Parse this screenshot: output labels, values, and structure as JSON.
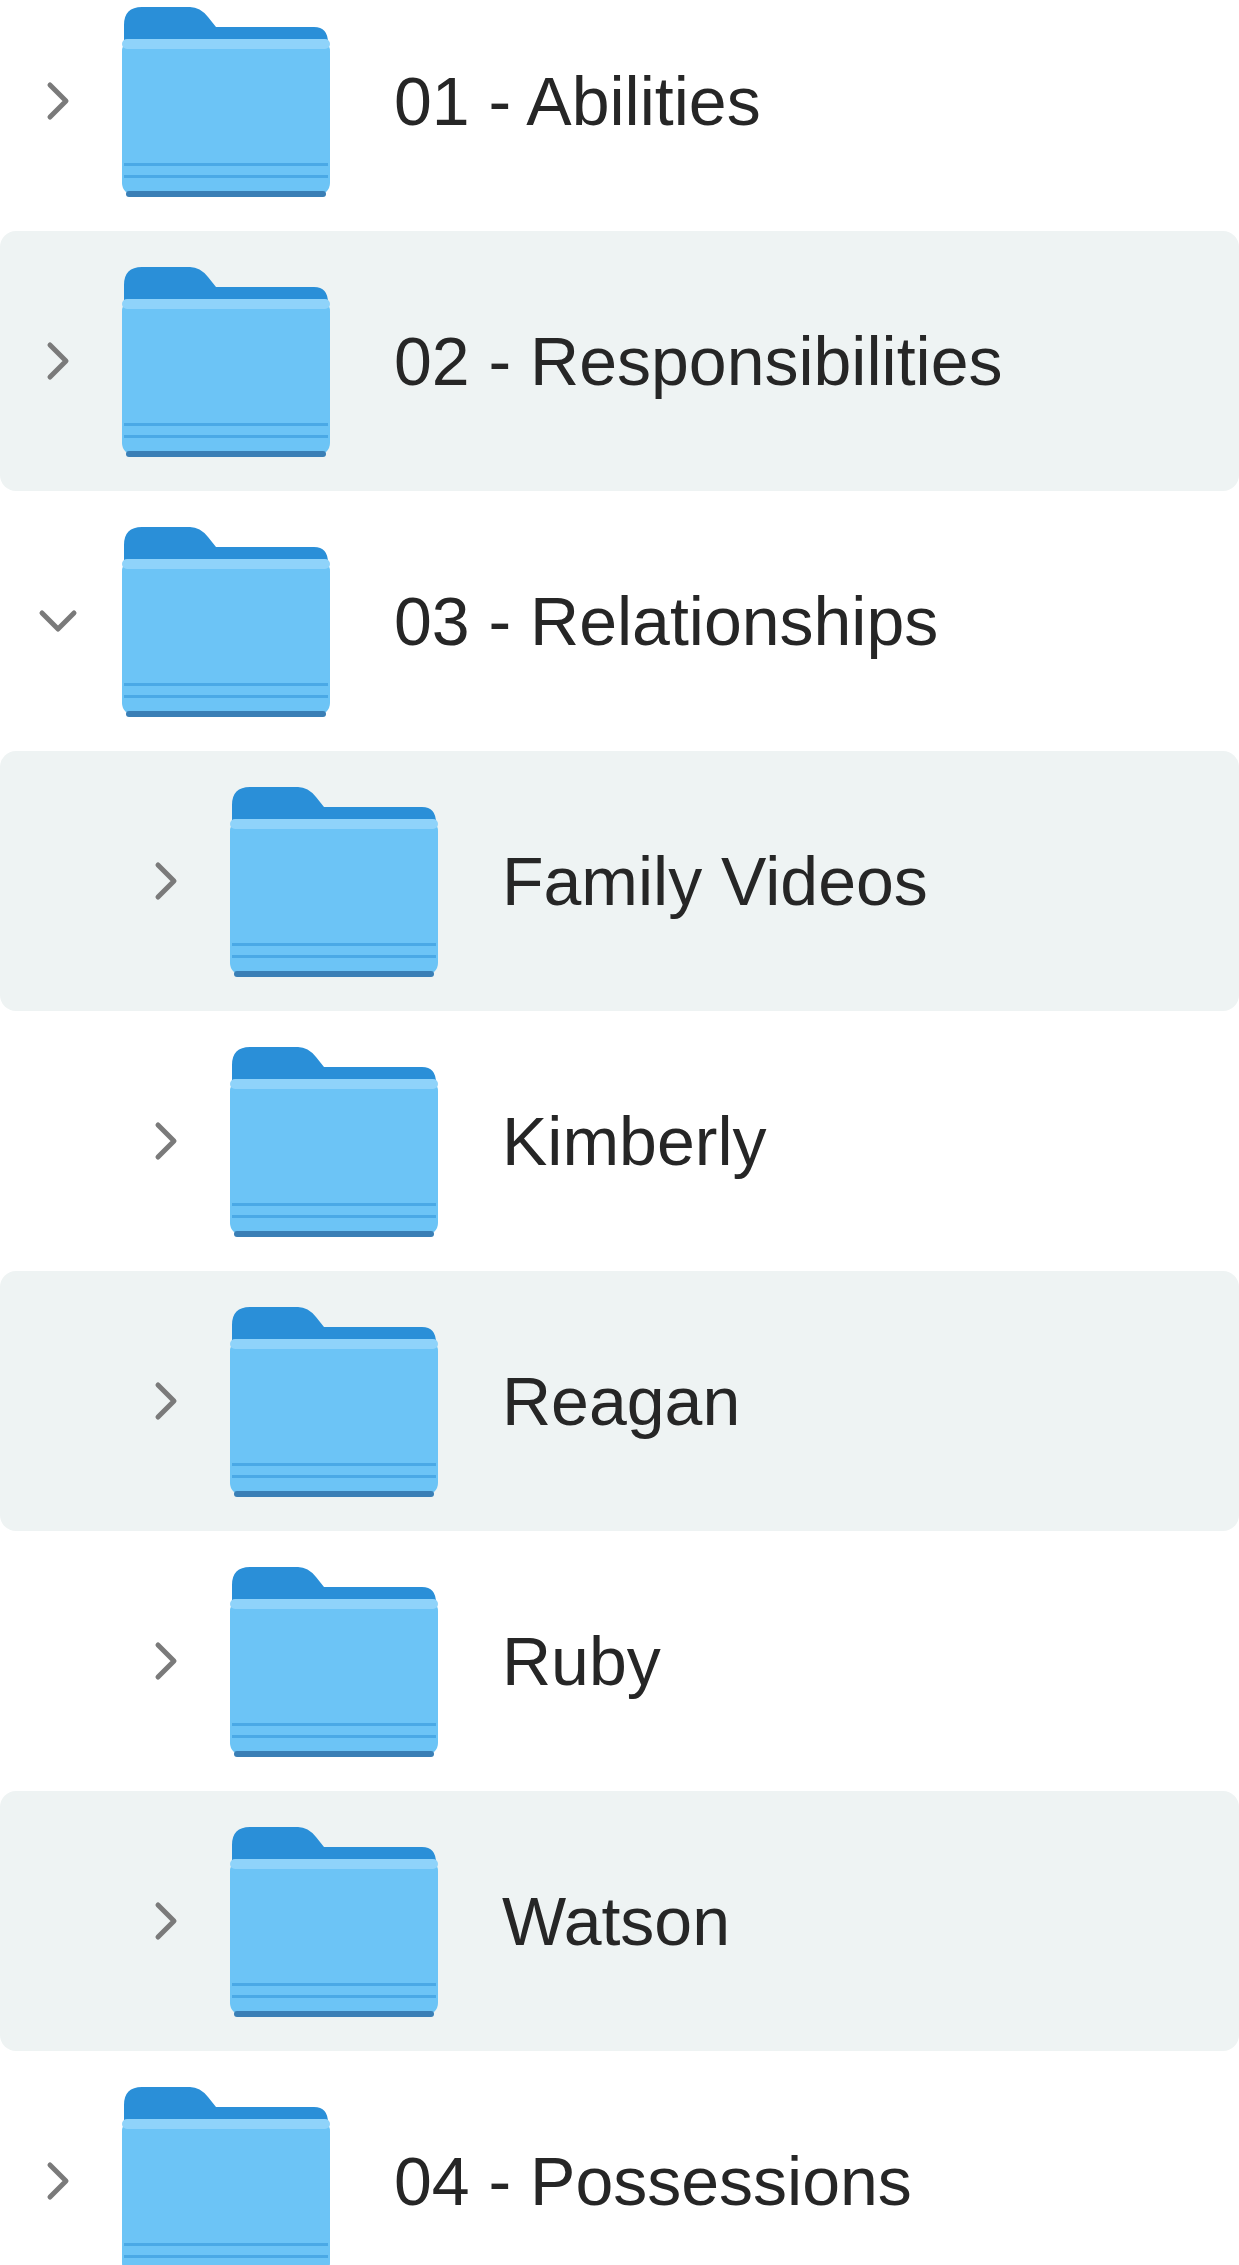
{
  "folders": [
    {
      "name": "01 - Abilities",
      "expanded": false
    },
    {
      "name": "02 - Responsibilities",
      "expanded": false
    },
    {
      "name": "03 - Relationships",
      "expanded": true,
      "children": [
        {
          "name": "Family Videos",
          "expanded": false
        },
        {
          "name": "Kimberly",
          "expanded": false
        },
        {
          "name": "Reagan",
          "expanded": false
        },
        {
          "name": "Ruby",
          "expanded": false
        },
        {
          "name": "Watson",
          "expanded": false
        }
      ]
    },
    {
      "name": "04 - Possessions",
      "expanded": false
    }
  ]
}
